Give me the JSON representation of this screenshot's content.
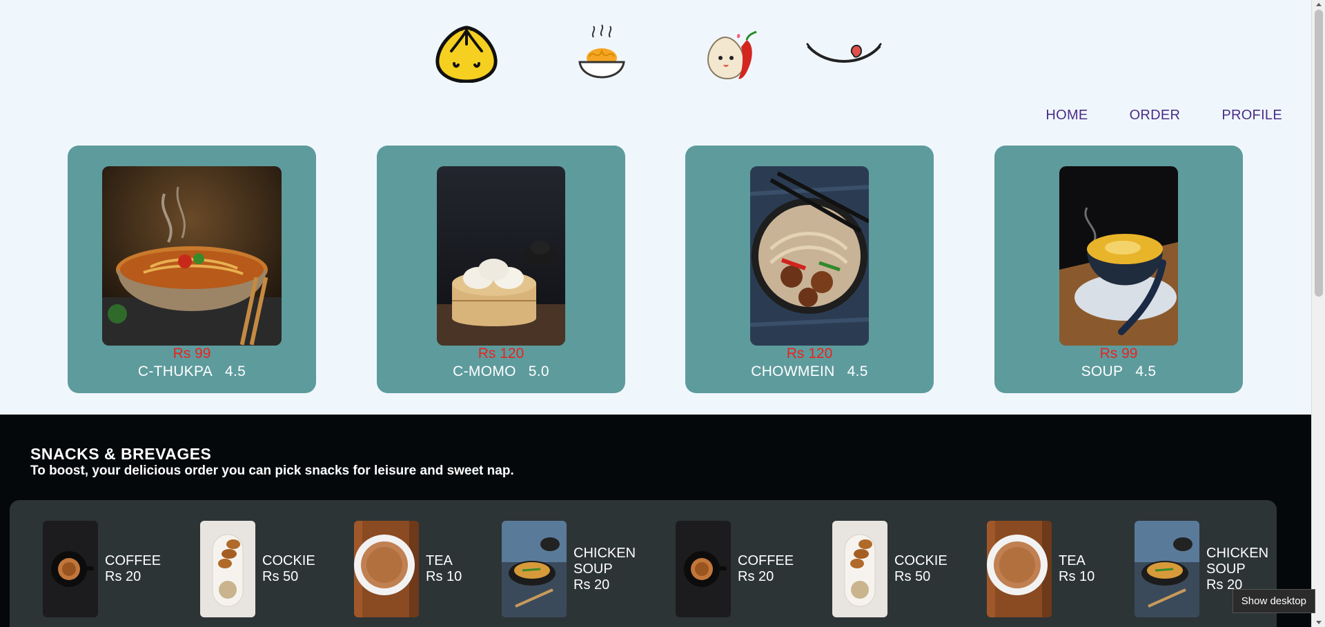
{
  "header": {
    "logos": [
      "bun-logo",
      "noodle-bowl-logo",
      "momo-chili-logo",
      "smile-tongue-logo"
    ]
  },
  "nav": {
    "home": "HOME",
    "order": "ORDER",
    "profile": "PROFILE"
  },
  "cards": [
    {
      "price": "Rs 99",
      "name": "C-THUKPA",
      "rating": "4.5",
      "image": "noodle-soup-photo"
    },
    {
      "price": "Rs 120",
      "name": "C-MOMO",
      "rating": "5.0",
      "image": "momo-steamer-photo"
    },
    {
      "price": "Rs 120",
      "name": "CHOWMEIN",
      "rating": "4.5",
      "image": "chowmein-photo"
    },
    {
      "price": "Rs 99",
      "name": "SOUP",
      "rating": "4.5",
      "image": "soup-bowl-photo"
    }
  ],
  "snacks_section": {
    "heading": "SNACKS & BREVAGES",
    "subheading": "To boost, your delicious order you can pick snacks for leisure and sweet nap.",
    "items": [
      {
        "line1": "COFFEE",
        "line2": "Rs 20",
        "line3": ""
      },
      {
        "line1": "COCKIE",
        "line2": "Rs 50",
        "line3": ""
      },
      {
        "line1": "TEA",
        "line2": "Rs 10",
        "line3": ""
      },
      {
        "line1": "CHICKEN",
        "line2": "SOUP",
        "line3": "Rs 20"
      },
      {
        "line1": "COFFEE",
        "line2": "Rs 20",
        "line3": ""
      },
      {
        "line1": "COCKIE",
        "line2": "Rs 50",
        "line3": ""
      },
      {
        "line1": "TEA",
        "line2": "Rs 10",
        "line3": ""
      },
      {
        "line1": "CHICKEN",
        "line2": "SOUP",
        "line3": "Rs 20"
      }
    ]
  },
  "tooltip": "Show desktop",
  "colors": {
    "page_bg": "#eff7fd",
    "card_bg": "#5e9b9d",
    "price": "#e8241f",
    "nav": "#4b2b86",
    "dark_section": "#05080b",
    "snack_bar": "#2d3436"
  }
}
